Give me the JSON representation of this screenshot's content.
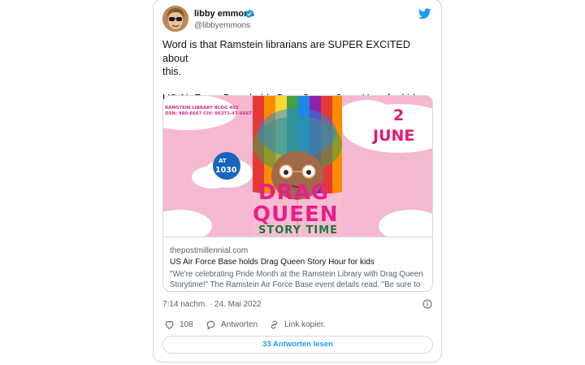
{
  "author": {
    "name": "libby emmons",
    "handle": "@libbyemmons"
  },
  "tweet": {
    "line1": "Word is that Ramstein librarians are SUPER EXCITED about",
    "line2": "this.",
    "line3": "US Air Force Base holds Drag Queen Story Hour for kids"
  },
  "preview_image": {
    "library": "RAMSTEIN LIBRARY BLDG 403",
    "phone": "DSN: 480-6667 CIV: 06371-47-6667",
    "date_day": "2",
    "date_month": "JUNE",
    "time_at": "AT",
    "time_value": "1030",
    "headline1": "DRAG",
    "headline2": "QUEEN",
    "headline3": "STORY TIME"
  },
  "link_card": {
    "domain": "thepostmillennial.com",
    "title": "US Air Force Base holds Drag Queen Story Hour for kids",
    "description": "\"We're celebrating Pride Month at the Ramstein Library with Drag Queen Storytime!\" The Ramstein Air Force Base event details read. \"Be sure to ..."
  },
  "timestamp": "7:14 nachm. · 24. Mai 2022",
  "actions": {
    "like_count": "108",
    "reply_label": "Antworten",
    "copy_label": "Link kopier."
  },
  "replies_button": "33 Antworten lesen",
  "colors": {
    "accent": "#1d9bf0",
    "border": "#cfd9de",
    "muted_text": "#536471",
    "preview_pink": "#e91e8c"
  }
}
